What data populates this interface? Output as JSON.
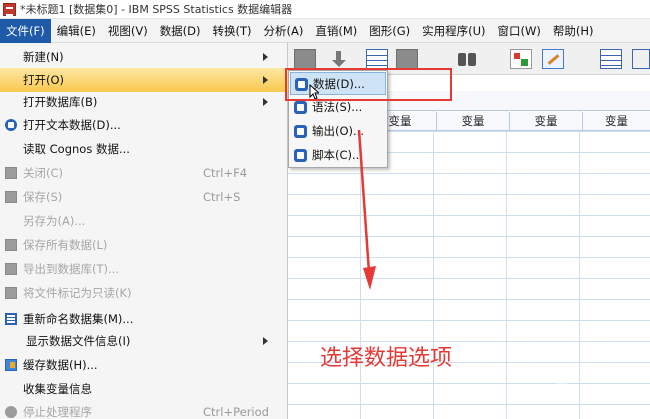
{
  "window": {
    "title": "*未标题1 [数据集0] - IBM SPSS Statistics 数据编辑器"
  },
  "menubar": [
    {
      "label": "文件(F)",
      "active": true
    },
    {
      "label": "编辑(E)"
    },
    {
      "label": "视图(V)"
    },
    {
      "label": "数据(D)"
    },
    {
      "label": "转换(T)"
    },
    {
      "label": "分析(A)"
    },
    {
      "label": "直销(M)"
    },
    {
      "label": "图形(G)"
    },
    {
      "label": "实用程序(U)"
    },
    {
      "label": "窗口(W)"
    },
    {
      "label": "帮助(H)"
    }
  ],
  "toolbar": {
    "icons": [
      "table-icon",
      "arrow-down-icon",
      "grid-icon",
      "gray-grid-icon",
      "binoculars-icon",
      "chart-icon",
      "edit-icon",
      "table-icon"
    ]
  },
  "file_menu": [
    {
      "label": "新建(N)",
      "shortcut": "",
      "submenu": true,
      "disabled": false,
      "icon": ""
    },
    {
      "label": "打开(O)",
      "shortcut": "",
      "submenu": true,
      "disabled": false,
      "icon": "",
      "highlight": true
    },
    {
      "label": "打开数据库(B)",
      "shortcut": "",
      "submenu": true,
      "disabled": false,
      "icon": ""
    },
    {
      "label": "打开文本数据(D)...",
      "shortcut": "",
      "submenu": false,
      "disabled": false,
      "icon": "text-data-icon"
    },
    {
      "label": "读取 Cognos 数据...",
      "shortcut": "",
      "submenu": false,
      "disabled": false,
      "icon": ""
    },
    {
      "label": "关闭(C)",
      "shortcut": "Ctrl+F4",
      "submenu": false,
      "disabled": true,
      "icon": "close-doc-icon"
    },
    {
      "label": "保存(S)",
      "shortcut": "Ctrl+S",
      "submenu": false,
      "disabled": true,
      "icon": "save-icon"
    },
    {
      "label": "另存为(A)...",
      "shortcut": "",
      "submenu": false,
      "disabled": true,
      "icon": ""
    },
    {
      "label": "保存所有数据(L)",
      "shortcut": "",
      "submenu": false,
      "disabled": true,
      "icon": "save-all-icon"
    },
    {
      "label": "导出到数据库(T)...",
      "shortcut": "",
      "submenu": false,
      "disabled": true,
      "icon": "export-db-icon"
    },
    {
      "label": "将文件标记为只读(K)",
      "shortcut": "",
      "submenu": false,
      "disabled": true,
      "icon": "readonly-icon"
    },
    {
      "label": "重新命名数据集(M)...",
      "shortcut": "",
      "submenu": false,
      "disabled": false,
      "icon": "rename-dataset-icon"
    },
    {
      "label": "显示数据文件信息(I)",
      "shortcut": "",
      "submenu": true,
      "disabled": false,
      "icon": ""
    },
    {
      "label": "缓存数据(H)...",
      "shortcut": "",
      "submenu": false,
      "disabled": false,
      "icon": "cache-data-icon"
    },
    {
      "label": "收集变量信息",
      "shortcut": "",
      "submenu": false,
      "disabled": false,
      "icon": ""
    },
    {
      "label": "停止处理程序",
      "shortcut": "Ctrl+Period",
      "submenu": false,
      "disabled": true,
      "icon": "stop-icon"
    }
  ],
  "open_submenu": [
    {
      "label": "数据(D)...",
      "hover": true
    },
    {
      "label": "语法(S)..."
    },
    {
      "label": "输出(O)..."
    },
    {
      "label": "脚本(C)..."
    }
  ],
  "grid": {
    "column_headers": [
      "变量",
      "变量",
      "变量",
      "变量"
    ]
  },
  "annotation": {
    "text": "选择数据选项",
    "color": "#e53935"
  }
}
